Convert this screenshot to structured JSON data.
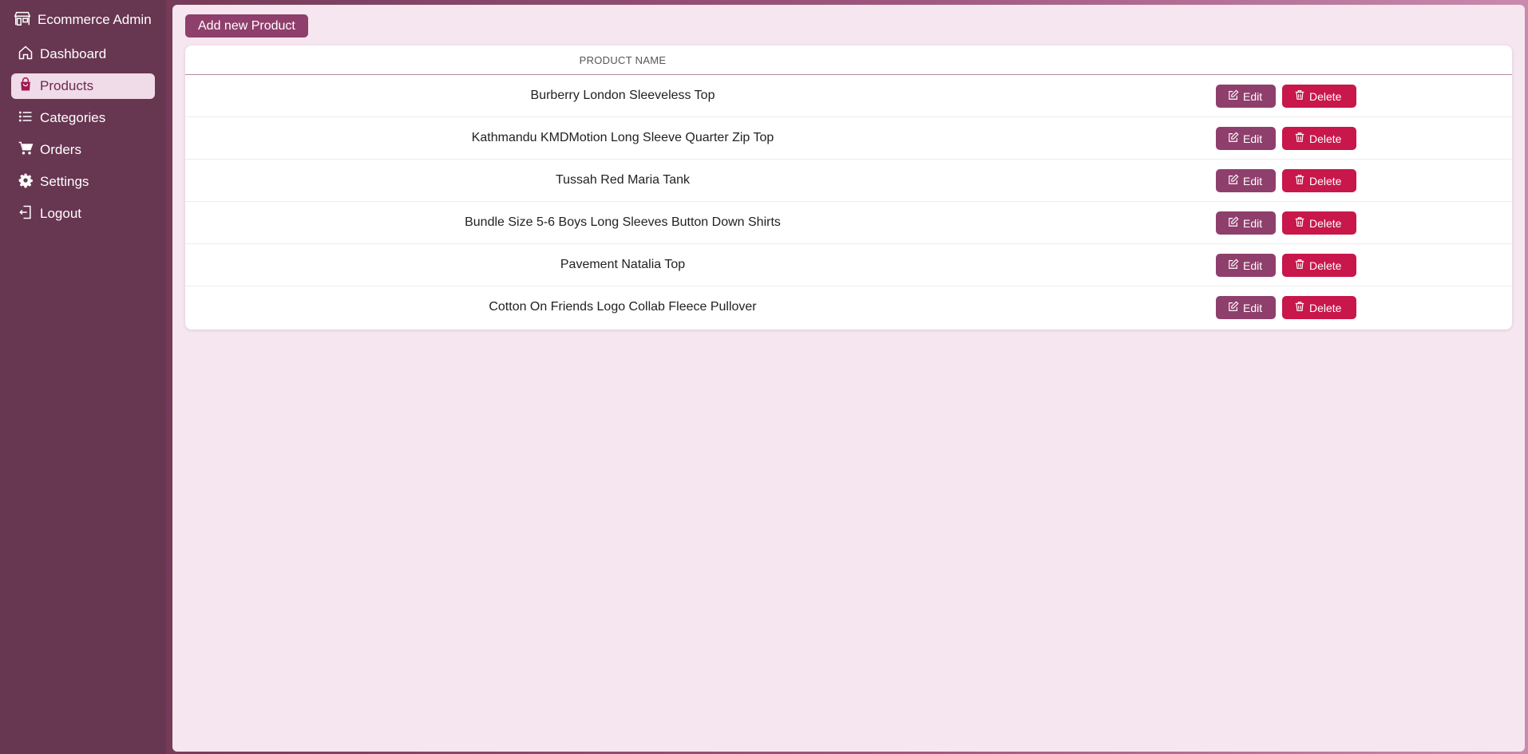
{
  "app": {
    "title": "Ecommerce Admin"
  },
  "sidebar": {
    "items": [
      {
        "label": "Dashboard",
        "icon": "home-icon",
        "active": false
      },
      {
        "label": "Products",
        "icon": "shopping-bag-icon",
        "active": true
      },
      {
        "label": "Categories",
        "icon": "list-icon",
        "active": false
      },
      {
        "label": "Orders",
        "icon": "cart-icon",
        "active": false
      },
      {
        "label": "Settings",
        "icon": "gear-icon",
        "active": false
      },
      {
        "label": "Logout",
        "icon": "logout-icon",
        "active": false
      }
    ]
  },
  "toolbar": {
    "add_label": "Add new Product"
  },
  "table": {
    "header": "PRODUCT NAME",
    "edit_label": "Edit",
    "delete_label": "Delete",
    "rows": [
      {
        "name": "Burberry London Sleeveless Top"
      },
      {
        "name": "Kathmandu KMDMotion Long Sleeve Quarter Zip Top"
      },
      {
        "name": "Tussah Red Maria Tank"
      },
      {
        "name": "Bundle Size 5-6 Boys Long Sleeves Button Down Shirts"
      },
      {
        "name": "Pavement Natalia Top"
      },
      {
        "name": "Cotton On Friends Logo Collab Fleece Pullover"
      }
    ]
  },
  "colors": {
    "sidebar_bg": "#673651",
    "accent": "#8f3f6c",
    "danger": "#c8174a",
    "main_bg": "#f5e6f0",
    "active_item_bg": "#f0dbe8"
  }
}
